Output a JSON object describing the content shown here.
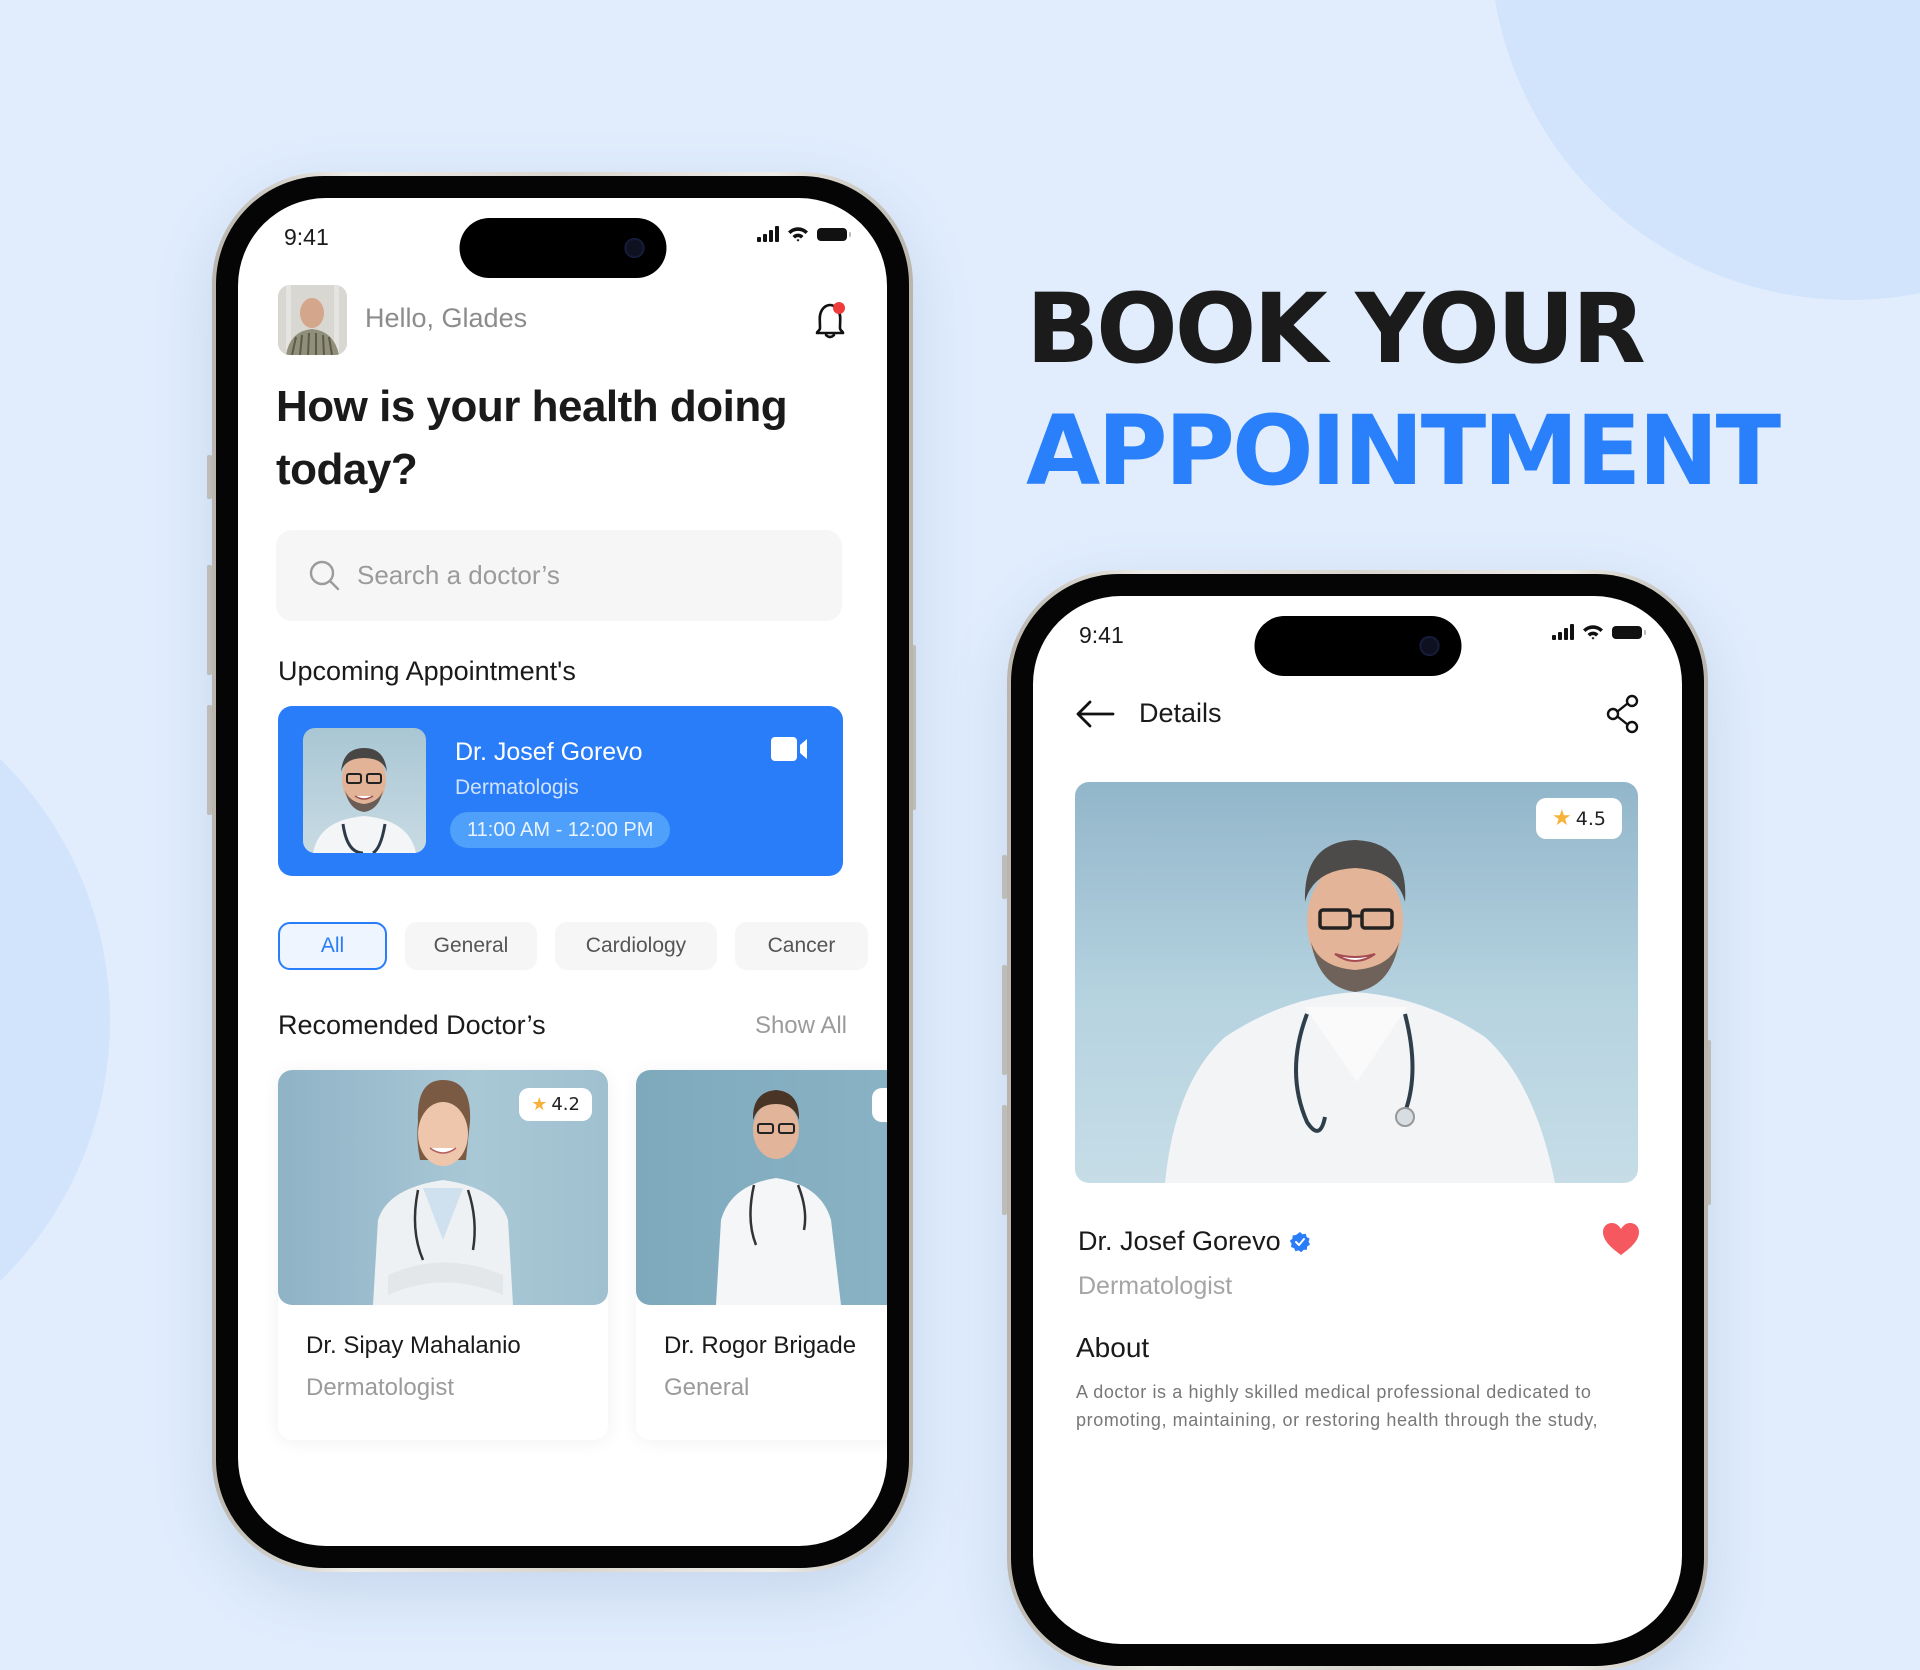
{
  "headline": {
    "line1": "BOOK YOUR",
    "line2": "APPOINTMENT"
  },
  "colors": {
    "accent": "#2a7df9",
    "headline_dark": "#1b1b1b",
    "background": "#e1edfd",
    "heart": "#f5585f",
    "star": "#f7b23b"
  },
  "home_screen": {
    "status": {
      "time": "9:41",
      "icons": [
        "signal-icon",
        "wifi-icon",
        "battery-icon"
      ]
    },
    "greeting": "Hello, Glades",
    "heading": "How is your health doing today?",
    "search": {
      "placeholder": "Search a doctor’s",
      "icon": "search-icon"
    },
    "upcoming": {
      "title": "Upcoming Appointment's",
      "doctor_name": "Dr. Josef Gorevo",
      "specialty": "Dermatologis",
      "time": "11:00 AM - 12:00 PM",
      "icon": "video-camera-icon"
    },
    "categories": [
      {
        "label": "All",
        "active": true
      },
      {
        "label": "General",
        "active": false
      },
      {
        "label": "Cardiology",
        "active": false
      },
      {
        "label": "Cancer",
        "active": false
      }
    ],
    "recommended": {
      "title": "Recomended Doctor’s",
      "show_all": "Show All",
      "doctors": [
        {
          "name": "Dr. Sipay Mahalanio",
          "specialty": "Dermatologist",
          "rating": "4.2"
        },
        {
          "name": "Dr. Rogor Brigade",
          "specialty": "General",
          "rating": ""
        }
      ]
    }
  },
  "details_screen": {
    "status": {
      "time": "9:41"
    },
    "title": "Details",
    "rating": "4.5",
    "doctor_name": "Dr. Josef Gorevo",
    "specialty": "Dermatologist",
    "about_title": "About",
    "about_text": "A doctor is a highly skilled medical professional dedicated to promoting, maintaining, or restoring health through the study,"
  }
}
